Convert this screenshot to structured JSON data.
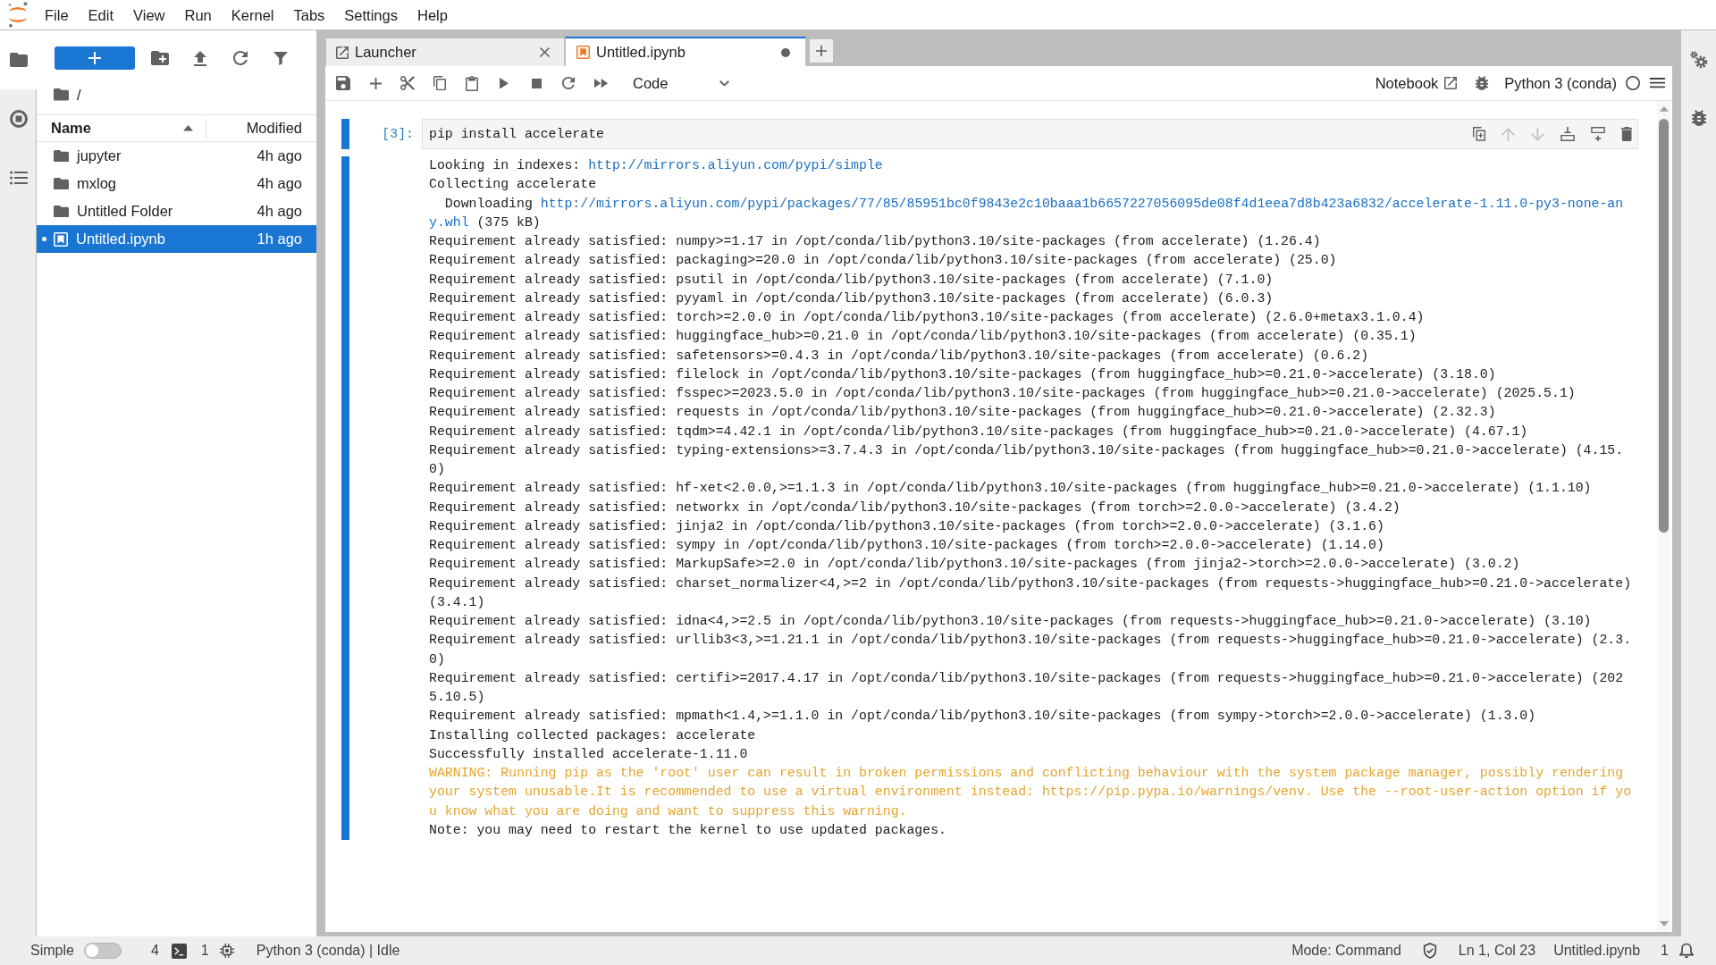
{
  "menu_bar": [
    "File",
    "Edit",
    "View",
    "Run",
    "Kernel",
    "Tabs",
    "Settings",
    "Help"
  ],
  "left_sidebar": [
    {
      "kind": "files",
      "selected": true
    },
    {
      "kind": "running",
      "selected": false
    },
    {
      "kind": "outline",
      "selected": false
    }
  ],
  "file_browser": {
    "path": "/",
    "columns": [
      {
        "label": "Name",
        "sorted": true
      },
      {
        "label": "Modified",
        "sorted": false
      }
    ],
    "items": [
      {
        "kind": "folder",
        "name": "jupyter",
        "modified": "4h ago",
        "selected": false,
        "running": false
      },
      {
        "kind": "folder",
        "name": "mxlog",
        "modified": "4h ago",
        "selected": false,
        "running": false
      },
      {
        "kind": "folder",
        "name": "Untitled Folder",
        "modified": "4h ago",
        "selected": false,
        "running": false
      },
      {
        "kind": "notebook",
        "name": "Untitled.ipynb",
        "modified": "1h ago",
        "selected": true,
        "running": true
      }
    ]
  },
  "tabs": [
    {
      "kind": "launcher",
      "label": "Launcher",
      "selected": false,
      "unsaved": false
    },
    {
      "kind": "notebook",
      "label": "Untitled.ipynb",
      "selected": true,
      "unsaved": true
    }
  ],
  "notebook_toolbar": {
    "cell_type": "Code",
    "view_label": "Notebook",
    "kernel": "Python 3 (conda)",
    "kernel_busy": false
  },
  "cells": [
    {
      "prompt": "[3]:",
      "source": "pip install accelerate",
      "selected": true,
      "toolbar": [
        {
          "kind": "duplicate",
          "disabled": false
        },
        {
          "kind": "move-up",
          "disabled": true
        },
        {
          "kind": "move-down",
          "disabled": true
        },
        {
          "kind": "insert-above",
          "disabled": false
        },
        {
          "kind": "insert-below",
          "disabled": false
        },
        {
          "kind": "delete",
          "disabled": false
        }
      ],
      "output": [
        {
          "kind": "plain",
          "parts": [
            {
              "kind": "text",
              "text": "Looking in indexes: "
            },
            {
              "kind": "link",
              "text": "http://mirrors.aliyun.com/pypi/simple"
            }
          ]
        },
        {
          "kind": "plain",
          "text": "Collecting accelerate"
        },
        {
          "kind": "plain",
          "parts": [
            {
              "kind": "text",
              "text": "  Downloading "
            },
            {
              "kind": "link",
              "text": "http://mirrors.aliyun.com/pypi/packages/77/85/85951bc0f9843e2c10baaa1b6657227056095de08f4d1eea7d8b423a6832/accelerate-1.11.0-py3-none-an"
            }
          ]
        },
        {
          "kind": "plain",
          "parts": [
            {
              "kind": "link",
              "text": "y.whl"
            },
            {
              "kind": "text",
              "text": " (375 kB)"
            }
          ]
        },
        {
          "kind": "plain",
          "text": "Requirement already satisfied: numpy>=1.17 in /opt/conda/lib/python3.10/site-packages (from accelerate) (1.26.4)"
        },
        {
          "kind": "plain",
          "text": "Requirement already satisfied: packaging>=20.0 in /opt/conda/lib/python3.10/site-packages (from accelerate) (25.0)"
        },
        {
          "kind": "plain",
          "text": "Requirement already satisfied: psutil in /opt/conda/lib/python3.10/site-packages (from accelerate) (7.1.0)"
        },
        {
          "kind": "plain",
          "text": "Requirement already satisfied: pyyaml in /opt/conda/lib/python3.10/site-packages (from accelerate) (6.0.3)"
        },
        {
          "kind": "plain",
          "text": "Requirement already satisfied: torch>=2.0.0 in /opt/conda/lib/python3.10/site-packages (from accelerate) (2.6.0+metax3.1.0.4)"
        },
        {
          "kind": "plain",
          "text": "Requirement already satisfied: huggingface_hub>=0.21.0 in /opt/conda/lib/python3.10/site-packages (from accelerate) (0.35.1)"
        },
        {
          "kind": "plain",
          "text": "Requirement already satisfied: safetensors>=0.4.3 in /opt/conda/lib/python3.10/site-packages (from accelerate) (0.6.2)"
        },
        {
          "kind": "plain",
          "text": "Requirement already satisfied: filelock in /opt/conda/lib/python3.10/site-packages (from huggingface_hub>=0.21.0->accelerate) (3.18.0)"
        },
        {
          "kind": "plain",
          "text": "Requirement already satisfied: fsspec>=2023.5.0 in /opt/conda/lib/python3.10/site-packages (from huggingface_hub>=0.21.0->accelerate) (2025.5.1)"
        },
        {
          "kind": "plain",
          "text": "Requirement already satisfied: requests in /opt/conda/lib/python3.10/site-packages (from huggingface_hub>=0.21.0->accelerate) (2.32.3)"
        },
        {
          "kind": "plain",
          "text": "Requirement already satisfied: tqdm>=4.42.1 in /opt/conda/lib/python3.10/site-packages (from huggingface_hub>=0.21.0->accelerate) (4.67.1)"
        },
        {
          "kind": "plain",
          "text": "Requirement already satisfied: typing-extensions>=3.7.4.3 in /opt/conda/lib/python3.10/site-packages (from huggingface_hub>=0.21.0->accelerate) (4.15."
        },
        {
          "kind": "plain",
          "text": "0)"
        },
        {
          "kind": "plain",
          "text": "Requirement already satisfied: hf-xet<2.0.0,>=1.1.3 in /opt/conda/lib/python3.10/site-packages (from huggingface_hub>=0.21.0->accelerate) (1.1.10)"
        },
        {
          "kind": "plain",
          "text": "Requirement already satisfied: networkx in /opt/conda/lib/python3.10/site-packages (from torch>=2.0.0->accelerate) (3.4.2)"
        },
        {
          "kind": "plain",
          "text": "Requirement already satisfied: jinja2 in /opt/conda/lib/python3.10/site-packages (from torch>=2.0.0->accelerate) (3.1.6)"
        },
        {
          "kind": "plain",
          "text": "Requirement already satisfied: sympy in /opt/conda/lib/python3.10/site-packages (from torch>=2.0.0->accelerate) (1.14.0)"
        },
        {
          "kind": "plain",
          "text": "Requirement already satisfied: MarkupSafe>=2.0 in /opt/conda/lib/python3.10/site-packages (from jinja2->torch>=2.0.0->accelerate) (3.0.2)"
        },
        {
          "kind": "plain",
          "text": "Requirement already satisfied: charset_normalizer<4,>=2 in /opt/conda/lib/python3.10/site-packages (from requests->huggingface_hub>=0.21.0->accelerate)"
        },
        {
          "kind": "plain",
          "text": "(3.4.1)"
        },
        {
          "kind": "plain",
          "text": "Requirement already satisfied: idna<4,>=2.5 in /opt/conda/lib/python3.10/site-packages (from requests->huggingface_hub>=0.21.0->accelerate) (3.10)"
        },
        {
          "kind": "plain",
          "text": "Requirement already satisfied: urllib3<3,>=1.21.1 in /opt/conda/lib/python3.10/site-packages (from requests->huggingface_hub>=0.21.0->accelerate) (2.3."
        },
        {
          "kind": "plain",
          "text": "0)"
        },
        {
          "kind": "plain",
          "text": "Requirement already satisfied: certifi>=2017.4.17 in /opt/conda/lib/python3.10/site-packages (from requests->huggingface_hub>=0.21.0->accelerate) (202"
        },
        {
          "kind": "plain",
          "text": "5.10.5)"
        },
        {
          "kind": "plain",
          "text": "Requirement already satisfied: mpmath<1.4,>=1.1.0 in /opt/conda/lib/python3.10/site-packages (from sympy->torch>=2.0.0->accelerate) (1.3.0)"
        },
        {
          "kind": "plain",
          "text": "Installing collected packages: accelerate"
        },
        {
          "kind": "plain",
          "text": "Successfully installed accelerate-1.11.0"
        },
        {
          "kind": "warning",
          "text": "WARNING: Running pip as the 'root' user can result in broken permissions and conflicting behaviour with the system package manager, possibly rendering"
        },
        {
          "kind": "warning",
          "text": "your system unusable.It is recommended to use a virtual environment instead: https://pip.pypa.io/warnings/venv. Use the --root-user-action option if yo"
        },
        {
          "kind": "warning",
          "text": "u know what you are doing and want to suppress this warning."
        },
        {
          "kind": "plain",
          "text": "Note: you may need to restart the kernel to use updated packages."
        }
      ]
    }
  ],
  "status_bar": {
    "simple_label": "Simple",
    "simple_on": false,
    "sessions": [
      {
        "kind": "terminal",
        "count": "4"
      },
      {
        "kind": "kernel",
        "count": "1"
      }
    ],
    "kernel_status": "Python 3 (conda) | Idle",
    "mode": "Mode: Command",
    "cursor": "Ln 1, Col 23",
    "file": "Untitled.ipynb",
    "notifications": "1"
  }
}
